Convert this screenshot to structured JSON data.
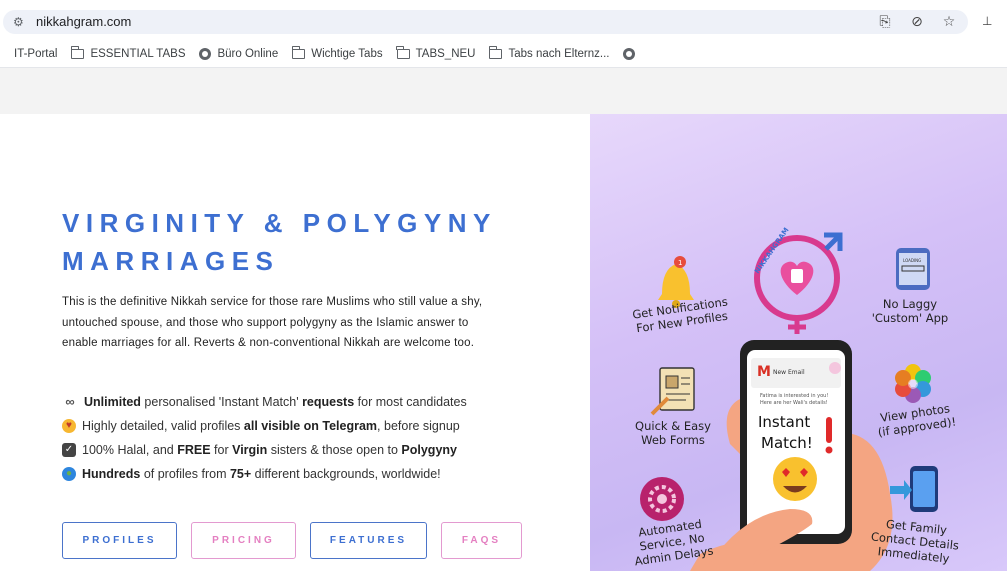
{
  "browser": {
    "url": "nikkahgram.com",
    "bookmarks": [
      {
        "label": "IT-Portal",
        "icon": "none"
      },
      {
        "label": "ESSENTIAL TABS",
        "icon": "folder-icon"
      },
      {
        "label": "Büro Online",
        "icon": "globe-icon"
      },
      {
        "label": "Wichtige Tabs",
        "icon": "folder-icon"
      },
      {
        "label": "TABS_NEU",
        "icon": "folder-icon"
      },
      {
        "label": "Tabs nach Elternz...",
        "icon": "folder-icon"
      },
      {
        "label": "",
        "icon": "globe-icon"
      }
    ]
  },
  "hero": {
    "title_line1": "VIRGINITY & POLYGYNY",
    "title_line2": "MARRIAGES",
    "intro_line1": "This is the definitive Nikkah service for those rare Muslims who still value a shy,",
    "intro_line2": "untouched spouse, and those who support polygyny as the Islamic answer to",
    "intro_line3": "enable marriages for all. Reverts & non-conventional Nikkah are welcome too."
  },
  "features": {
    "f1_a": "Unlimited",
    "f1_b": " personalised 'Instant Match' ",
    "f1_c": "requests",
    "f1_d": " for most candidates",
    "f2_a": " Highly detailed, valid profiles ",
    "f2_b": "all visible on Telegram",
    "f2_c": ", before signup",
    "f3_a": " 100% Halal, and ",
    "f3_b": "FREE",
    "f3_c": " for ",
    "f3_d": "Virgin",
    "f3_e": " sisters & those open to ",
    "f3_f": "Polygyny",
    "f4_a": " ",
    "f4_b": "Hundreds",
    "f4_c": " of profiles from ",
    "f4_d": "75+",
    "f4_e": " different backgrounds, worldwide!"
  },
  "buttons": {
    "profiles": "PROFILES",
    "pricing": "PRICING",
    "features": "FEATURES",
    "faqs": "FAQS"
  },
  "promo": {
    "logo_text": "NIKKAHGRAM",
    "notif_line1": "Get Notifications",
    "notif_line2": "For New Profiles",
    "nolaggy_line1": "No Laggy",
    "nolaggy_line2": "'Custom' App",
    "forms_line1": "Quick & Easy",
    "forms_line2": "Web Forms",
    "photos_line1": "View photos",
    "photos_line2": "(if approved)!",
    "auto_line1": "Automated",
    "auto_line2": "Service, No",
    "auto_line3": "Admin Delays",
    "family_line1": "Get Family",
    "family_line2": "Contact Details",
    "family_line3": "Immediately",
    "phone_email_label": "New Email",
    "phone_email_text1": "Fatima is interested in you!",
    "phone_email_text2": "Here are her Wali's details!",
    "phone_match_line1": "Instant",
    "phone_match_line2": "Match!",
    "loading_text": "LOADING",
    "notif_badge": "1"
  },
  "colors": {
    "title_blue": "#3d6fd1",
    "button_pink": "#e47fc1",
    "promo_bg": "#d4c0f7"
  }
}
